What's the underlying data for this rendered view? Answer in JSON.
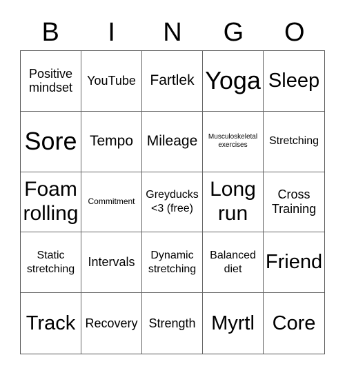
{
  "header": {
    "letters": [
      "B",
      "I",
      "N",
      "G",
      "O"
    ]
  },
  "grid": {
    "cells": [
      "Positive mindset",
      "YouTube",
      "Fartlek",
      "Yoga",
      "Sleep",
      "Sore",
      "Tempo",
      "Mileage",
      "Musculoskeletal exercises",
      "Stretching",
      "Foam rolling",
      "Commitment",
      "Greyducks <3 (free)",
      "Long run",
      "Cross Training",
      "Static stretching",
      "Intervals",
      "Dynamic stretching",
      "Balanced diet",
      "Friend",
      "Track",
      "Recovery",
      "Strength",
      "Myrtl",
      "Core"
    ]
  }
}
